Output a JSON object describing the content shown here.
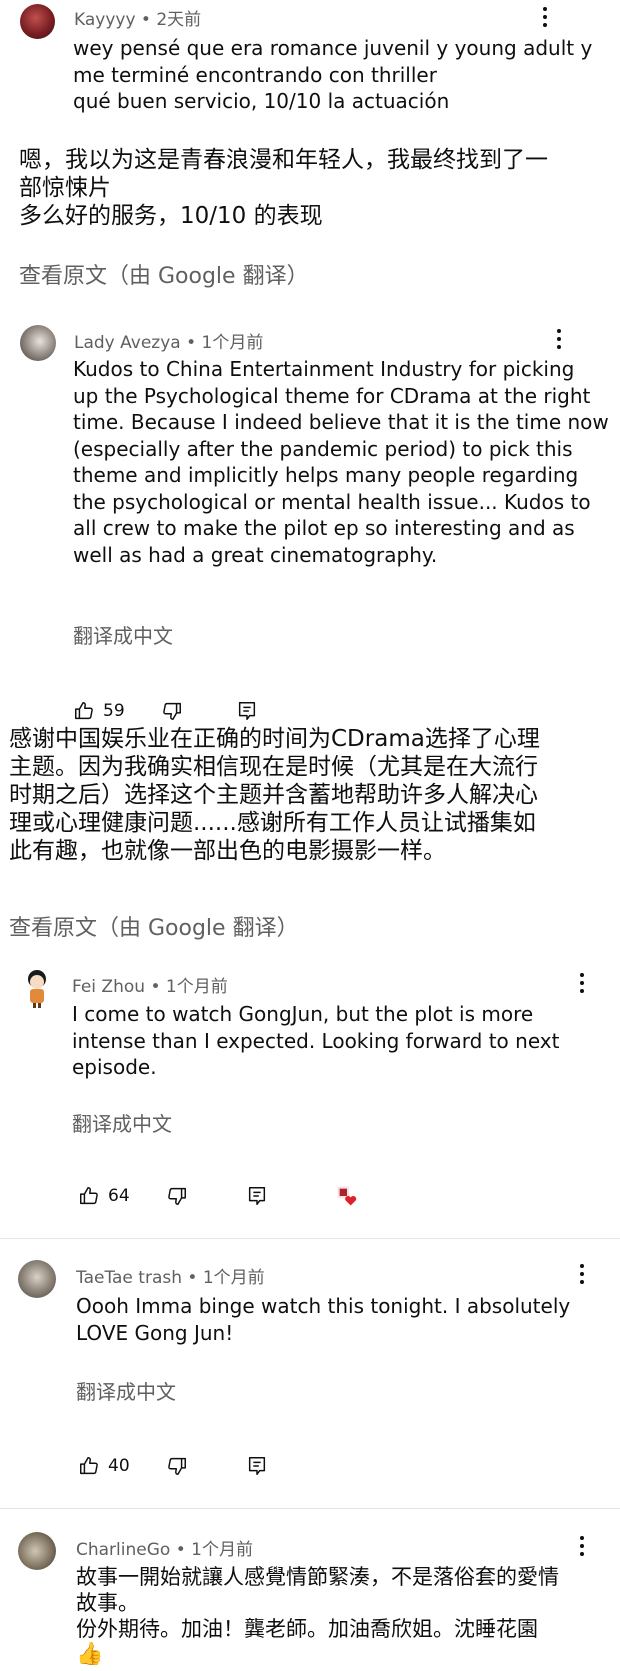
{
  "comments": [
    {
      "author": "Kayyyy",
      "time": "2天前",
      "text_lines": [
        "wey pensé que era romance juvenil y young adult y",
        "me terminé encontrando con thriller",
        "qué buen servicio, 10/10 la actuación"
      ],
      "translation_lines": [
        "嗯，我以为这是青春浪漫和年轻人，我最终找到了一",
        "部惊悚片",
        "多么好的服务，10/10 的表现"
      ],
      "view_original": "查看原文（由 Google 翻译）"
    },
    {
      "author": "Lady Avezya",
      "time": "1个月前",
      "text_lines": [
        "Kudos to China Entertainment Industry for picking",
        "up the Psychological theme for CDrama at the right",
        "time. Because I indeed believe that it is the time now",
        "(especially after the pandemic period) to pick this",
        "theme and implicitly helps many people regarding",
        "the psychological or mental health issue... Kudos to",
        "all crew to make the pilot ep so interesting and as",
        "well as had a great cinematography."
      ],
      "translate_label": "翻译成中文",
      "likes": "59",
      "translation_lines": [
        "感谢中国娱乐业在正确的时间为CDrama选择了心理",
        "主题。因为我确实相信现在是时候（尤其是在大流行",
        "时期之后）选择这个主题并含蓄地帮助许多人解决心",
        "理或心理健康问题......感谢所有工作人员让试播集如",
        "此有趣，也就像一部出色的电影摄影一样。"
      ],
      "view_original": "查看原文（由 Google 翻译）"
    },
    {
      "author": "Fei Zhou",
      "time": "1个月前",
      "text_lines": [
        "I come to watch GongJun, but the plot is more",
        "intense than I expected. Looking forward to next",
        "episode."
      ],
      "translate_label": "翻译成中文",
      "likes": "64"
    },
    {
      "author": "TaeTae trash",
      "time": "1个月前",
      "text_lines": [
        "Oooh Imma binge watch this tonight. I absolutely",
        "LOVE Gong Jun!"
      ],
      "translate_label": "翻译成中文",
      "likes": "40"
    },
    {
      "author": "CharlineGo",
      "time": "1个月前",
      "text_lines": [
        "故事一開始就讓人感覺情節緊湊，不是落俗套的愛情",
        "故事。",
        "份外期待。加油！龔老師。加油喬欣姐。沈睡花園"
      ],
      "emoji": "👍"
    }
  ],
  "separator": "•",
  "colors": {
    "text": "#0f0f0f",
    "meta": "#606060",
    "heart": "#e0202a",
    "divider": "#e5e5e5"
  },
  "icons": [
    "thumb-up-icon",
    "thumb-down-icon",
    "reply-icon",
    "more-vert-icon",
    "creator-heart-icon"
  ]
}
